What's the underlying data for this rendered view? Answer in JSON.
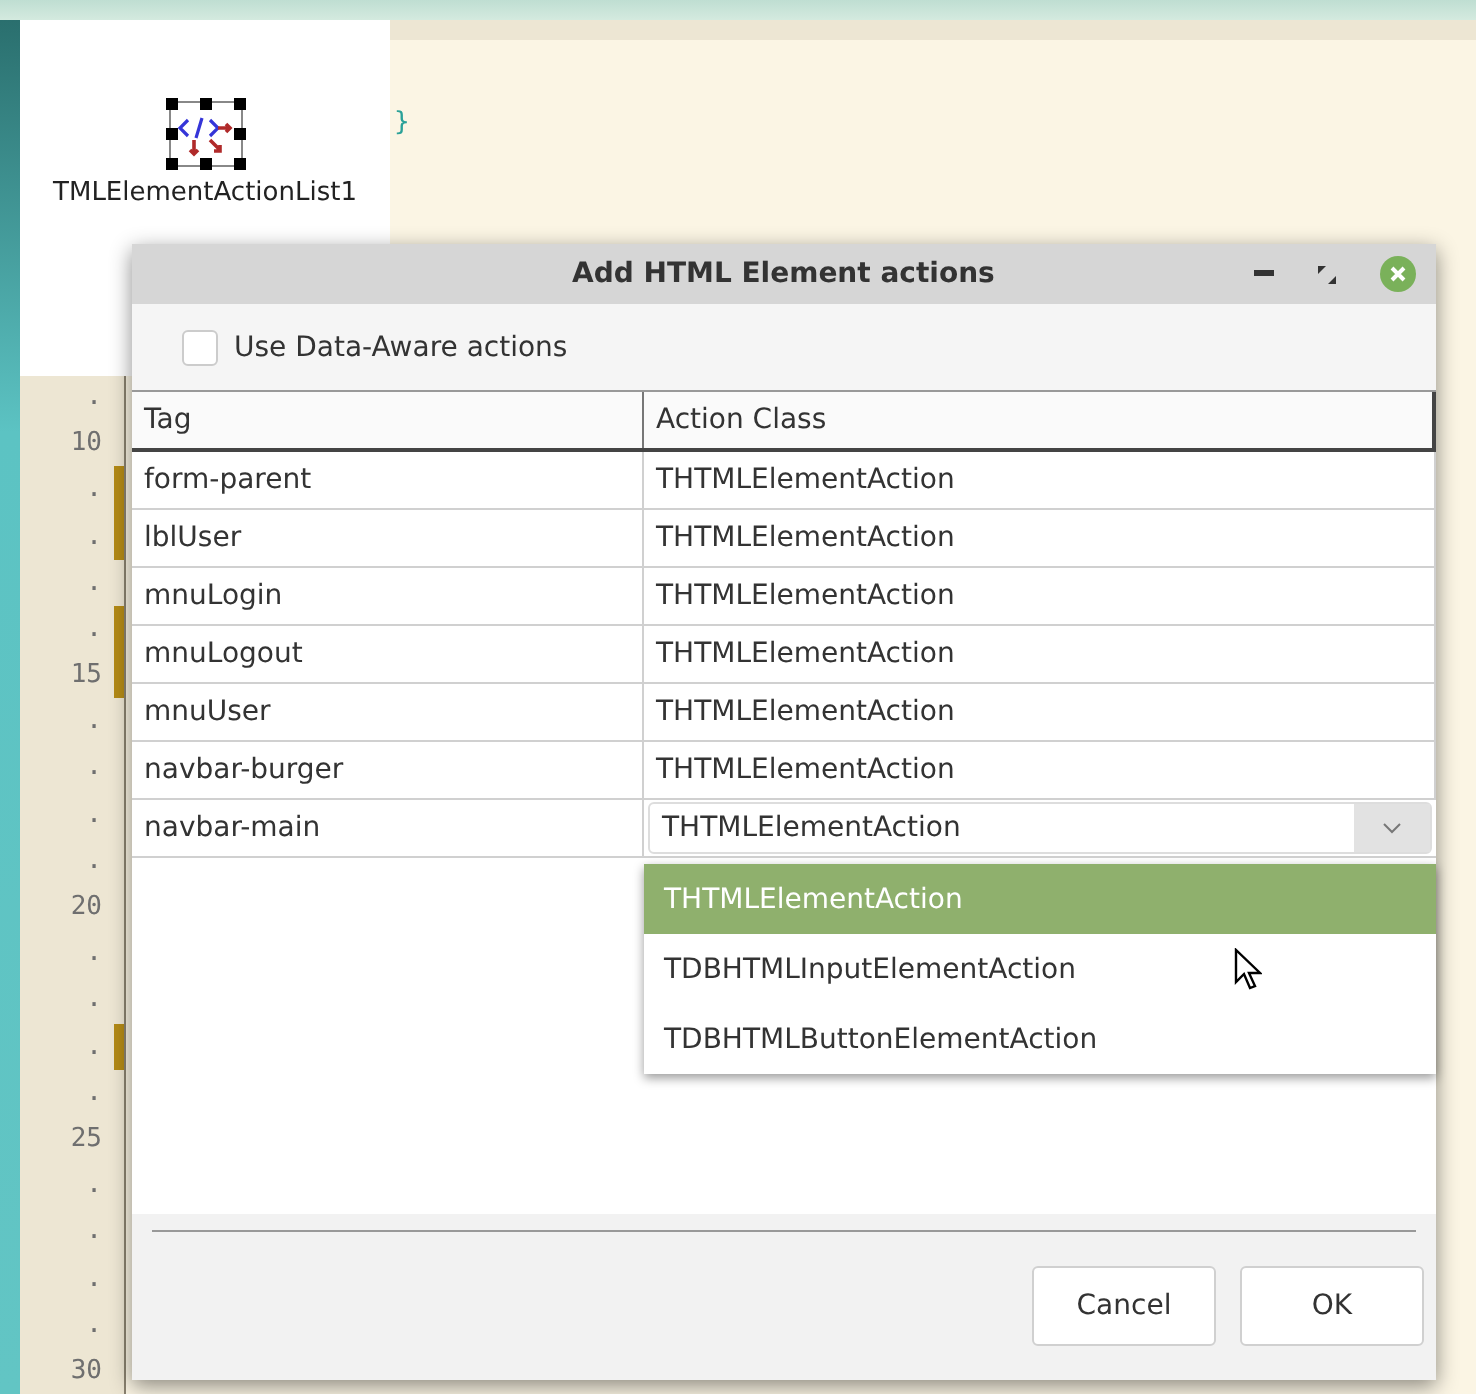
{
  "editor": {
    "code_fragment": "}",
    "gutter": [
      {
        "label": ".",
        "modified": false
      },
      {
        "label": "10",
        "modified": false
      },
      {
        "label": ".",
        "modified": true
      },
      {
        "label": ".",
        "modified": true
      },
      {
        "label": ".",
        "modified": false
      },
      {
        "label": ".",
        "modified": true
      },
      {
        "label": "15",
        "modified": true
      },
      {
        "label": ".",
        "modified": false
      },
      {
        "label": ".",
        "modified": false
      },
      {
        "label": ".",
        "modified": false
      },
      {
        "label": ".",
        "modified": false
      },
      {
        "label": "20",
        "modified": false
      },
      {
        "label": ".",
        "modified": false
      },
      {
        "label": ".",
        "modified": false
      },
      {
        "label": ".",
        "modified": true
      },
      {
        "label": ".",
        "modified": false
      },
      {
        "label": "25",
        "modified": false
      },
      {
        "label": ".",
        "modified": false
      },
      {
        "label": ".",
        "modified": false
      },
      {
        "label": ".",
        "modified": false
      },
      {
        "label": ".",
        "modified": false
      },
      {
        "label": "30",
        "modified": false
      }
    ]
  },
  "designer": {
    "component_label": "TMLElementActionList1"
  },
  "dialog": {
    "title": "Add HTML Element actions",
    "checkbox": {
      "label": "Use Data-Aware actions",
      "checked": false
    },
    "table": {
      "columns": [
        "Tag",
        "Action Class"
      ],
      "rows": [
        {
          "tag": "form-parent",
          "action_class": "THTMLElementAction",
          "editing": false
        },
        {
          "tag": "lblUser",
          "action_class": "THTMLElementAction",
          "editing": false
        },
        {
          "tag": "mnuLogin",
          "action_class": "THTMLElementAction",
          "editing": false
        },
        {
          "tag": "mnuLogout",
          "action_class": "THTMLElementAction",
          "editing": false
        },
        {
          "tag": "mnuUser",
          "action_class": "THTMLElementAction",
          "editing": false
        },
        {
          "tag": "navbar-burger",
          "action_class": "THTMLElementAction",
          "editing": false
        },
        {
          "tag": "navbar-main",
          "action_class": "THTMLElementAction",
          "editing": true
        }
      ]
    },
    "dropdown_options": [
      {
        "label": "THTMLElementAction",
        "selected": true
      },
      {
        "label": "TDBHTMLInputElementAction",
        "selected": false
      },
      {
        "label": "TDBHTMLButtonElementAction",
        "selected": false
      }
    ],
    "buttons": [
      "Cancel",
      "OK"
    ]
  }
}
